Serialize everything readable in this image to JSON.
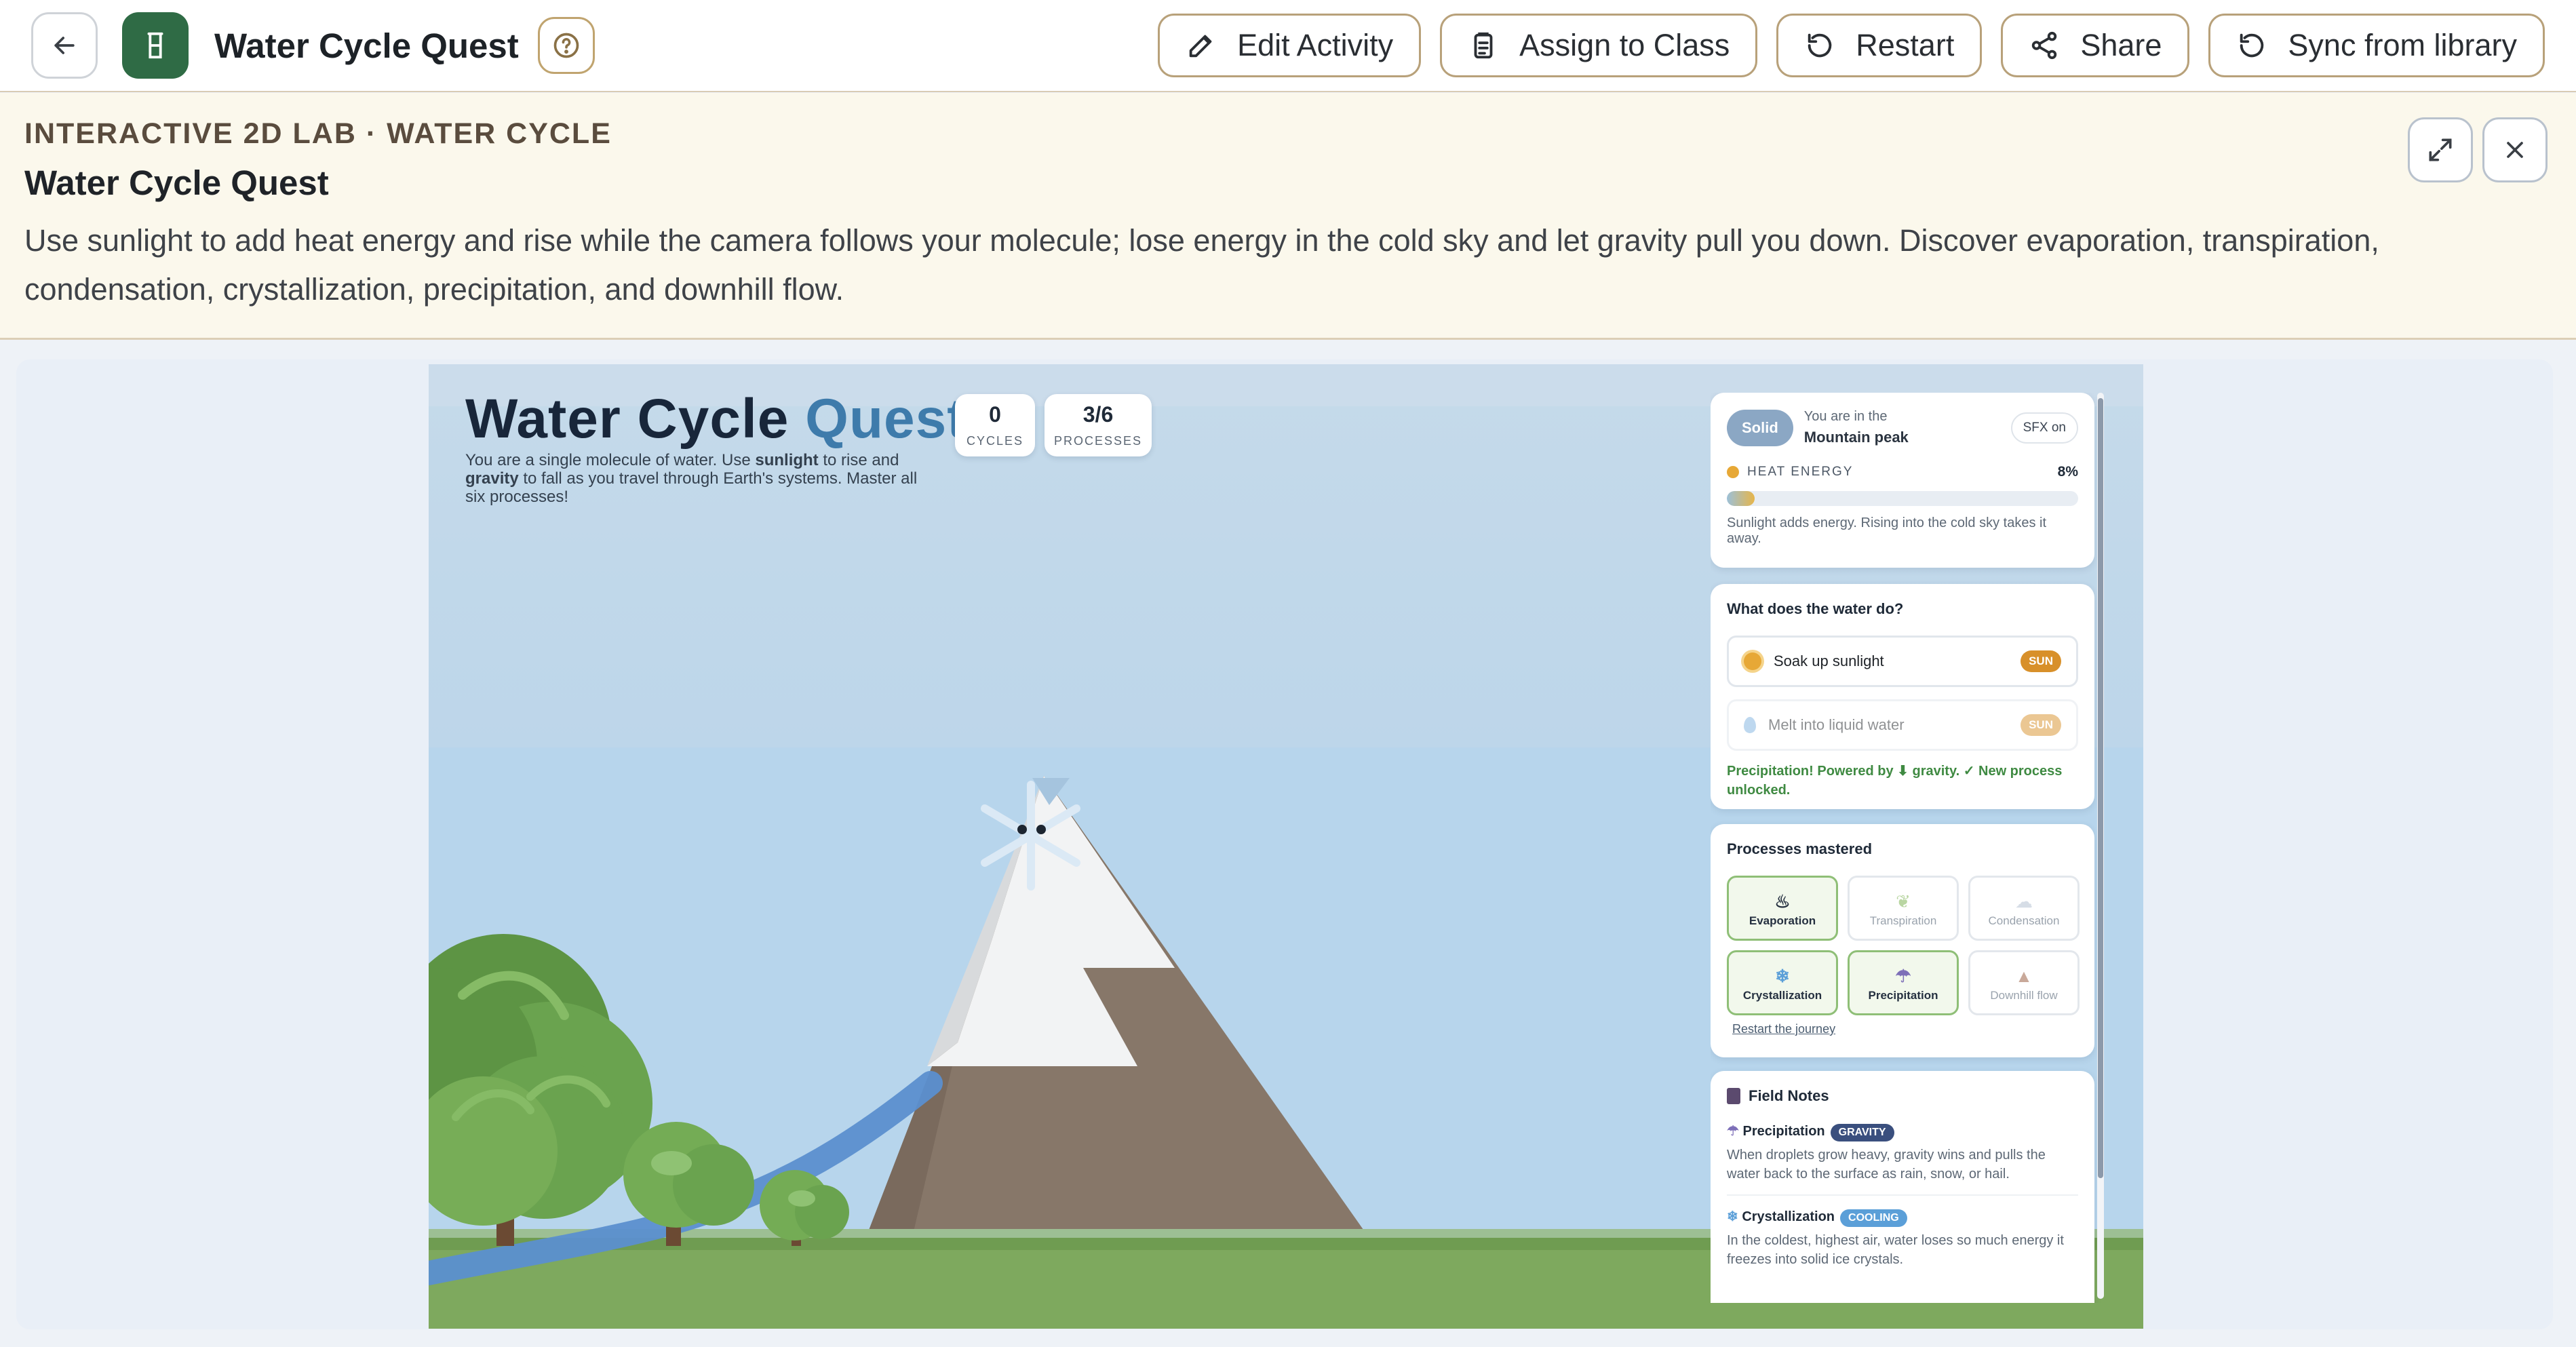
{
  "topbar": {
    "title": "Water Cycle Quest",
    "actions": [
      {
        "label": "Edit Activity",
        "icon": "edit-icon"
      },
      {
        "label": "Assign to Class",
        "icon": "clipboard-icon"
      },
      {
        "label": "Restart",
        "icon": "restart-icon"
      },
      {
        "label": "Share",
        "icon": "share-icon"
      },
      {
        "label": "Sync from library",
        "icon": "sync-icon"
      }
    ]
  },
  "banner": {
    "kicker": "INTERACTIVE 2D LAB · WATER CYCLE",
    "title": "Water Cycle Quest",
    "description": "Use sunlight to add heat energy and rise while the camera follows your molecule; lose energy in the cold sky and let gravity pull you down. Discover evaporation, transpiration, condensation, crystallization, precipitation, and downhill flow."
  },
  "game": {
    "title_a": "Water Cycle",
    "title_b": "Quest",
    "intro_a": "You are a single molecule of water. Use ",
    "intro_sun": "sunlight",
    "intro_b": " to rise and ",
    "intro_grav": "gravity",
    "intro_c": " to fall as you travel through Earth's systems. Master all six processes!",
    "cycles_value": "0",
    "cycles_label": "CYCLES",
    "processes_value": "3/6",
    "processes_label": "PROCESSES",
    "state": {
      "phase": "Solid",
      "location_prefix": "You are in the",
      "location": "Mountain peak",
      "sfx": "SFX on",
      "heat_label": "HEAT ENERGY",
      "heat_value": "8%",
      "heat_fraction": 0.08,
      "heat_hint": "Sunlight adds energy. Rising into the cold sky takes it away."
    },
    "actions": {
      "heading": "What does the water do?",
      "options": [
        {
          "label": "Soak up sunlight",
          "tag": "SUN"
        },
        {
          "label": "Melt into liquid water",
          "tag": "SUN"
        }
      ],
      "feedback": "Precipitation! Powered by ⬇ gravity. ✓ New process unlocked."
    },
    "processes": {
      "heading": "Processes mastered",
      "items": [
        {
          "label": "Evaporation",
          "mastered": true
        },
        {
          "label": "Transpiration",
          "mastered": false
        },
        {
          "label": "Condensation",
          "mastered": false
        },
        {
          "label": "Crystallization",
          "mastered": true
        },
        {
          "label": "Precipitation",
          "mastered": true
        },
        {
          "label": "Downhill flow",
          "mastered": false
        }
      ],
      "restart_link": "Restart the journey"
    },
    "notes": {
      "heading": "Field Notes",
      "entries": [
        {
          "title": "Precipitation",
          "tag": "GRAVITY",
          "tag_color": "#3a4f7e",
          "text": "When droplets grow heavy, gravity wins and pulls the water back to the surface as rain, snow, or hail."
        },
        {
          "title": "Crystallization",
          "tag": "COOLING",
          "tag_color": "#5b9fd8",
          "text": "In the coldest, highest air, water loses so much energy it freezes into solid ice crystals."
        }
      ]
    }
  },
  "colors": {
    "accent_green": "#2f6b45",
    "border_gold": "#b8a17a",
    "quest_blue": "#3e7bab"
  }
}
